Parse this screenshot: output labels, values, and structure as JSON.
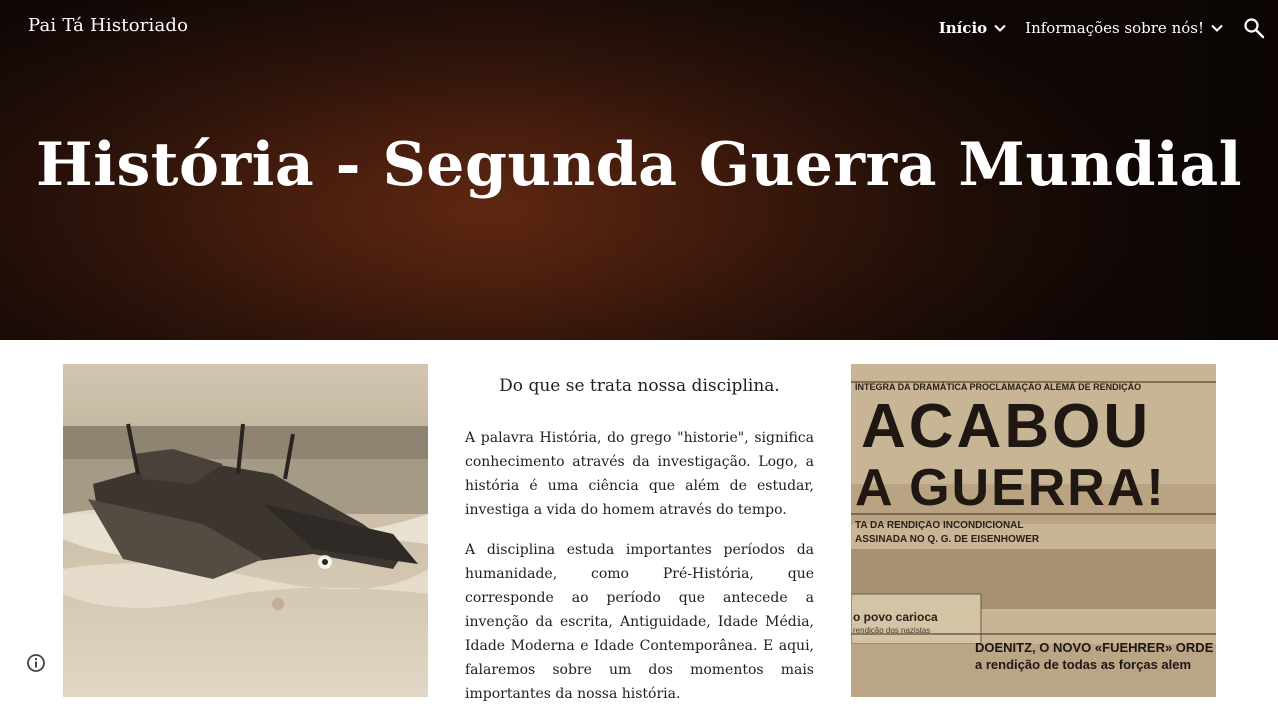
{
  "header": {
    "site_title": "Pai Tá Historiado",
    "nav": [
      {
        "label": "Início",
        "active": true
      },
      {
        "label": "Informações sobre nós!",
        "active": false
      }
    ],
    "search_icon": "search-icon"
  },
  "hero": {
    "title": "História - Segunda Guerra Mundial",
    "background_color": "#4a1e0e"
  },
  "main": {
    "section_title": "Do que se trata nossa disciplina.",
    "paragraphs": [
      "A palavra História, do grego \"historie\", significa conhecimento através da investigação. Logo, a história é uma ciência que além de estudar, investiga a vida do homem através do tempo.",
      "A disciplina estuda importantes períodos da humanidade, como Pré-História, que corresponde ao período que antecede a invenção da escrita, Antiguidade, Idade Média, Idade Moderna e Idade Contemporânea. E aqui, falaremos sobre um dos momentos mais importantes da nossa história."
    ],
    "newspaper": {
      "top_line": "ÍNTEGRA DA DRAMÁTICA PROCLAMAÇÃO ALEMÃ DE RENDIÇÃO",
      "headline_1": "ACABOU",
      "headline_2": "A GUERRA!",
      "subline_1": "TA DA RENDIÇÃO INCONDICIONAL",
      "subline_2": "ASSINADA NO Q. G. DE EISENHOWER",
      "box_text_1": "o povo carioca",
      "box_text_2": "rendição dos nazistas",
      "bottom_headline": "DOENITZ, O NOVO «FUEHRER» ORDE",
      "bottom_subline": "a rendição de todas as forças alem"
    }
  },
  "footer": {
    "info_icon": "info-icon"
  }
}
